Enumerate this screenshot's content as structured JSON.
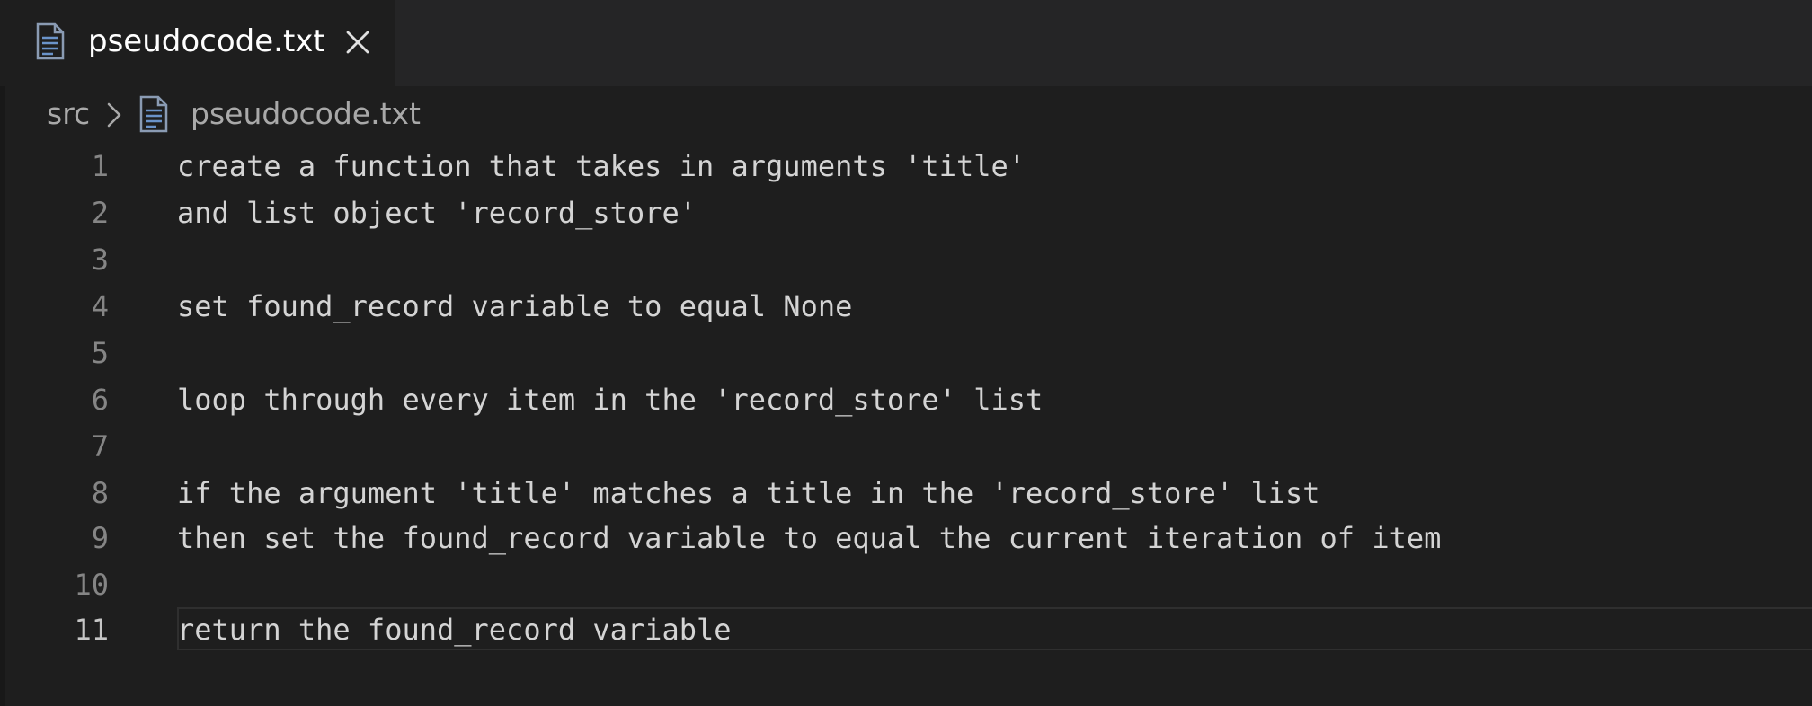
{
  "tab": {
    "label": "pseudocode.txt",
    "icon": "file-text-icon",
    "close_icon": "close-icon"
  },
  "breadcrumb": {
    "folder": "src",
    "separator_icon": "chevron-right-icon",
    "file_icon": "file-text-icon",
    "file": "pseudocode.txt"
  },
  "editor": {
    "active_line": 11,
    "lines": [
      {
        "number": "1",
        "text": "create a function that takes in arguments 'title'"
      },
      {
        "number": "2",
        "text": "and list object 'record_store'"
      },
      {
        "number": "3",
        "text": ""
      },
      {
        "number": "4",
        "text": "set found_record variable to equal None"
      },
      {
        "number": "5",
        "text": ""
      },
      {
        "number": "6",
        "text": "loop through every item in the 'record_store' list"
      },
      {
        "number": "7",
        "text": ""
      },
      {
        "number": "8",
        "text": "if the argument 'title' matches a title in the 'record_store' list"
      },
      {
        "number": "9",
        "text": "then set the found_record variable to equal the current iteration of item"
      },
      {
        "number": "10",
        "text": ""
      },
      {
        "number": "11",
        "text": "return the found_record variable"
      }
    ]
  },
  "colors": {
    "editor_background": "#1e1e1e",
    "tabbar_background": "#252526",
    "text": "#d4d4d4",
    "line_number": "#858585",
    "icon_blue": "#6a93c9"
  }
}
